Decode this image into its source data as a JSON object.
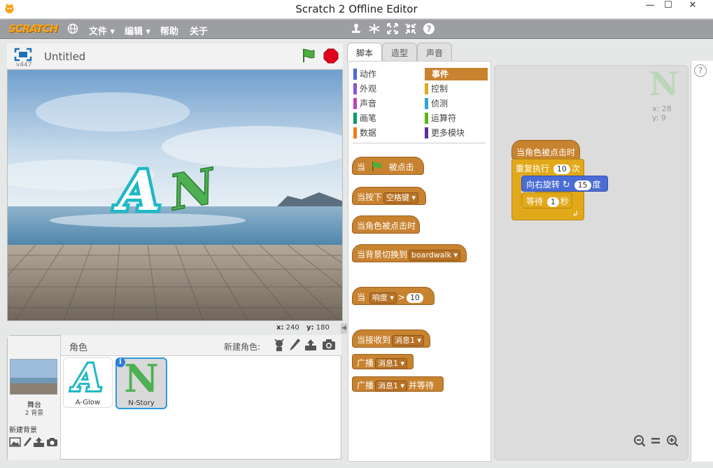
{
  "window": {
    "title": "Scratch 2 Offline Editor",
    "min": "—",
    "max": "☐",
    "close": "✕"
  },
  "menu": {
    "logo": "SCRATCH",
    "file": "文件 ▾",
    "edit": "编辑 ▾",
    "help": "帮助",
    "about": "关于"
  },
  "stage": {
    "title": "Untitled",
    "version": "v447",
    "x_label": "x:",
    "x_value": "240",
    "y_label": "y:",
    "y_value": "180",
    "sprite_a": "A",
    "sprite_n": "N"
  },
  "sprites": {
    "header": "角色",
    "new_sprite": "新建角色:",
    "stage_label": "舞台",
    "backdrop_count": "2 背景",
    "new_backdrop": "新建背景",
    "items": [
      {
        "name": "A-Glow",
        "glyph": "A"
      },
      {
        "name": "N-Story",
        "glyph": "N"
      }
    ],
    "info": "i"
  },
  "tabs": [
    "脚本",
    "造型",
    "声音"
  ],
  "categories": [
    {
      "label": "动作",
      "color": "#4a6cd4"
    },
    {
      "label": "事件",
      "color": "#c88330"
    },
    {
      "label": "外观",
      "color": "#8a55d7"
    },
    {
      "label": "控制",
      "color": "#e1a91a"
    },
    {
      "label": "声音",
      "color": "#bb42c3"
    },
    {
      "label": "侦测",
      "color": "#2ca5e2"
    },
    {
      "label": "画笔",
      "color": "#0e9a6c"
    },
    {
      "label": "运算符",
      "color": "#5cb712"
    },
    {
      "label": "数据",
      "color": "#ee7d16"
    },
    {
      "label": "更多模块",
      "color": "#632d99"
    }
  ],
  "blocks": {
    "flag_when": "当",
    "flag_clicked": "被点击",
    "key_when": "当按下",
    "key_value": "空格键",
    "sprite_clicked": "当角色被点击时",
    "backdrop_switch": "当背景切换到",
    "backdrop_value": "boardwalk",
    "when": "当",
    "loudness": "响度",
    "gt": ">",
    "gt_value": "10",
    "receive": "当接收到",
    "message": "消息1",
    "broadcast": "广播",
    "broadcast_wait": "并等待"
  },
  "script": {
    "hat": "当角色被点击时",
    "repeat": "重复执行",
    "repeat_count": "10",
    "repeat_unit": "次",
    "turn": "向右旋转",
    "turn_deg": "15",
    "turn_unit": "度",
    "wait": "等待",
    "wait_sec": "1",
    "wait_unit": "秒",
    "sprite_glyph": "N",
    "sprite_x": "x: 28",
    "sprite_y": "y: 9"
  },
  "help": "?",
  "zoom": {
    "out": "−",
    "reset": "=",
    "in": "+"
  }
}
